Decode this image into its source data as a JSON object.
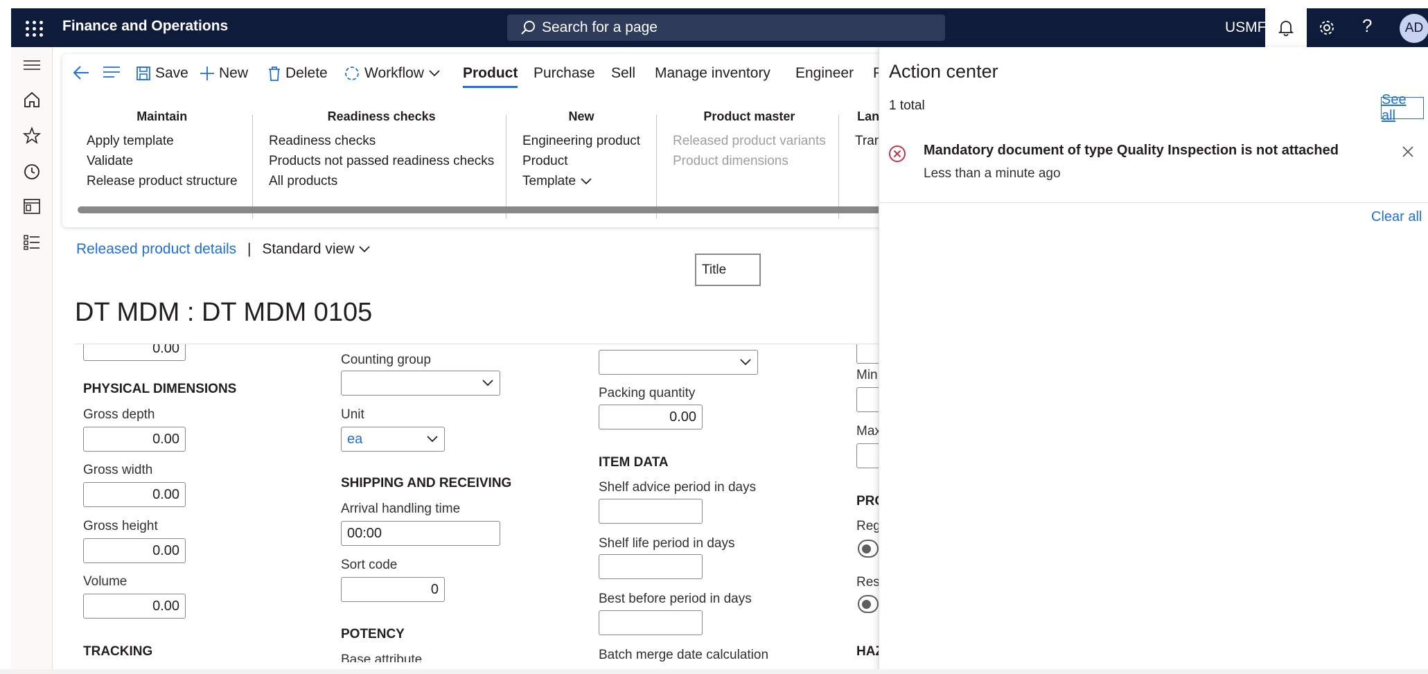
{
  "app": {
    "title": "Finance and Operations",
    "company": "USMF",
    "avatar": "AD",
    "help": "?"
  },
  "search": {
    "placeholder": "Search for a page"
  },
  "toolbar": {
    "save": "Save",
    "new": "New",
    "delete": "Delete",
    "workflow": "Workflow",
    "tabs": [
      "Product",
      "Purchase",
      "Sell",
      "Manage inventory",
      "Engineer",
      "P"
    ]
  },
  "groups": {
    "maintain": {
      "title": "Maintain",
      "items": [
        "Apply template",
        "Validate",
        "Release product structure"
      ]
    },
    "readiness": {
      "title": "Readiness checks",
      "items": [
        "Readiness checks",
        "Products not passed readiness checks",
        "All products"
      ]
    },
    "new": {
      "title": "New",
      "items": [
        "Engineering product",
        "Product",
        "Template"
      ]
    },
    "product_master": {
      "title": "Product master",
      "items": [
        "Released product variants",
        "Product dimensions"
      ]
    },
    "lang": {
      "title": "Lan",
      "items": [
        "Tran"
      ]
    }
  },
  "breadcrumb": {
    "link": "Released product details",
    "sep": "|",
    "view": "Standard view"
  },
  "title_box": "Title",
  "page_title": "DT MDM : DT MDM 0105",
  "form": {
    "col1": {
      "top_value": "0.00",
      "section_physical": "PHYSICAL DIMENSIONS",
      "gross_depth_label": "Gross depth",
      "gross_depth": "0.00",
      "gross_width_label": "Gross width",
      "gross_width": "0.00",
      "gross_height_label": "Gross height",
      "gross_height": "0.00",
      "volume_label": "Volume",
      "volume": "0.00",
      "section_tracking": "TRACKING"
    },
    "col2": {
      "counting_group_label": "Counting group",
      "counting_group": "",
      "unit_label": "Unit",
      "unit": "ea",
      "section_shipping": "SHIPPING AND RECEIVING",
      "arrival_label": "Arrival handling time",
      "arrival": "00:00",
      "sort_label": "Sort code",
      "sort": "0",
      "section_potency": "POTENCY",
      "base_attr_label": "Base attribute"
    },
    "col3": {
      "packing_qty_label": "Packing quantity",
      "packing_qty": "0.00",
      "section_item": "ITEM DATA",
      "shelf_advice_label": "Shelf advice period in days",
      "shelf_life_label": "Shelf life period in days",
      "best_before_label": "Best before period in days",
      "batch_merge_label": "Batch merge date calculation"
    },
    "col4": {
      "min_label": "Min",
      "max_label": "Max",
      "section_pro": "PRO",
      "reg_label": "Reg",
      "res_label": "Res",
      "section_haz": "HAZ"
    }
  },
  "action_center": {
    "title": "Action center",
    "total": "1 total",
    "see_all": "See all",
    "message": "Mandatory document of type Quality Inspection is not attached",
    "time": "Less than a minute ago",
    "clear_all": "Clear all"
  }
}
